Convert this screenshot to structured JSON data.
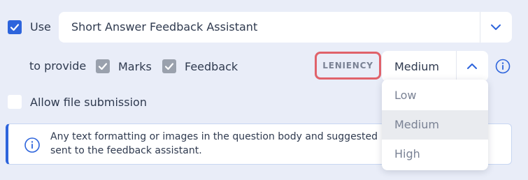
{
  "row_use": {
    "checkbox_checked": true,
    "label": "Use",
    "assistant_select_value": "Short Answer Feedback Assistant"
  },
  "row_provide": {
    "label": "to provide",
    "marks": {
      "label": "Marks",
      "checked": true
    },
    "feedback": {
      "label": "Feedback",
      "checked": true
    },
    "leniency_label": "LENIENCY",
    "leniency_value": "Medium"
  },
  "row_file": {
    "label": "Allow file submission",
    "checked": false
  },
  "notice": {
    "text": "Any text formatting or images in the question body and suggested sent to the feedback assistant."
  },
  "leniency_dropdown": {
    "options": [
      "Low",
      "Medium",
      "High"
    ],
    "highlighted": "Medium"
  },
  "colors": {
    "background": "#e9edf8",
    "accent": "#2d64dc",
    "highlight_border": "#e0626a",
    "muted_checkbox": "#9aa1ad"
  },
  "icons": {
    "check": "check-icon",
    "chevron_down": "chevron-down-icon",
    "chevron_up": "chevron-up-icon",
    "info": "info-icon"
  }
}
